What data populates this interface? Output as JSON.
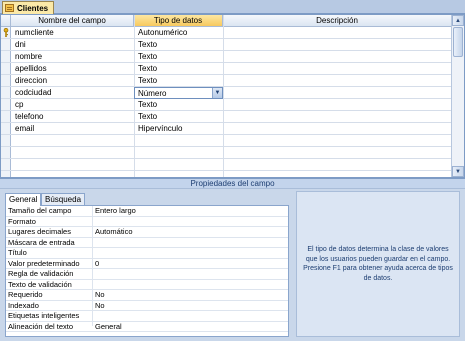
{
  "window": {
    "tab_title": "Clientes"
  },
  "grid": {
    "headers": {
      "field_name": "Nombre del campo",
      "data_type": "Tipo de datos",
      "description": "Descripción"
    },
    "rows": [
      {
        "name": "numcliente",
        "type": "Autonumérico",
        "description": "",
        "primary_key": true
      },
      {
        "name": "dni",
        "type": "Texto",
        "description": ""
      },
      {
        "name": "nombre",
        "type": "Texto",
        "description": ""
      },
      {
        "name": "apellidos",
        "type": "Texto",
        "description": ""
      },
      {
        "name": "direccion",
        "type": "Texto",
        "description": ""
      },
      {
        "name": "codciudad",
        "type": "Número",
        "description": "",
        "selected": true
      },
      {
        "name": "cp",
        "type": "Texto",
        "description": ""
      },
      {
        "name": "telefono",
        "type": "Texto",
        "description": ""
      },
      {
        "name": "email",
        "type": "Hipervínculo",
        "description": ""
      }
    ],
    "icons": {
      "primary_key": "key-icon",
      "dropdown": "chevron-down-icon",
      "scroll_up": "arrow-up-icon",
      "scroll_down": "arrow-down-icon"
    }
  },
  "properties": {
    "title": "Propiedades del campo",
    "tabs": [
      {
        "label": "General",
        "active": true
      },
      {
        "label": "Búsqueda",
        "active": false
      }
    ],
    "rows": [
      {
        "label": "Tamaño del campo",
        "value": "Entero largo"
      },
      {
        "label": "Formato",
        "value": ""
      },
      {
        "label": "Lugares decimales",
        "value": "Automático"
      },
      {
        "label": "Máscara de entrada",
        "value": ""
      },
      {
        "label": "Título",
        "value": ""
      },
      {
        "label": "Valor predeterminado",
        "value": "0"
      },
      {
        "label": "Regla de validación",
        "value": ""
      },
      {
        "label": "Texto de validación",
        "value": ""
      },
      {
        "label": "Requerido",
        "value": "No"
      },
      {
        "label": "Indexado",
        "value": "No"
      },
      {
        "label": "Etiquetas inteligentes",
        "value": ""
      },
      {
        "label": "Alineación del texto",
        "value": "General"
      }
    ],
    "help_text": "El tipo de datos determina la clase de valores que los usuarios pueden guardar en el campo. Presione F1 para obtener ayuda acerca de tipos de datos."
  },
  "colors": {
    "tab_active": "#fbe9a8",
    "selected_header": "#f7c95f",
    "accent": "#1d3e72",
    "panel": "#c9d7ea"
  }
}
